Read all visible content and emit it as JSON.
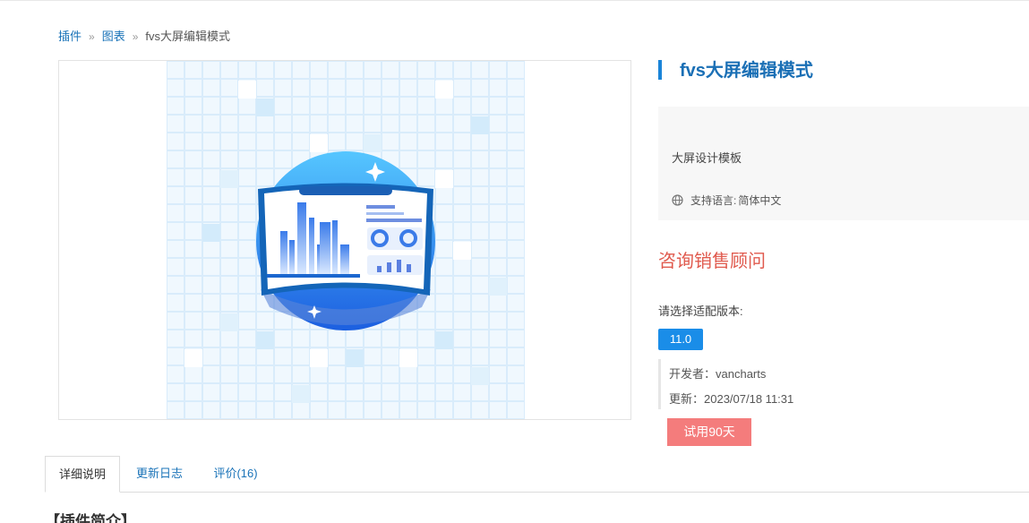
{
  "breadcrumb": {
    "items": [
      "插件",
      "图表"
    ],
    "separator": "»",
    "current": "fvs大屏编辑模式"
  },
  "product": {
    "title": "fvs大屏编辑模式",
    "description": "大屏设计模板",
    "language_label": "支持语言:",
    "language_value": "简体中文",
    "consult": "咨询销售顾问",
    "version_label": "请选择适配版本:",
    "version": "11.0",
    "developer": "开发者：vancharts",
    "updated": "更新：2023/07/18 11:31",
    "trial": "试用90天"
  },
  "tabs": [
    {
      "label": "详细说明",
      "active": true
    },
    {
      "label": "更新日志",
      "active": false
    },
    {
      "label": "评价(16)",
      "active": false
    }
  ],
  "section_heading": "【插件简介】",
  "colors": {
    "accent": "#1a84d8",
    "consult": "#e05a4e",
    "trial": "#f47c7c",
    "version": "#1a8de8"
  },
  "icons": {
    "language": "globe-icon",
    "sparkle": "sparkle-icon"
  }
}
